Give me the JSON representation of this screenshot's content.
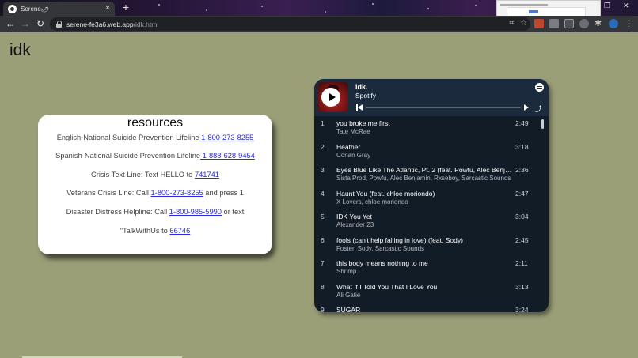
{
  "browser": {
    "tab_title": "Serene🌶",
    "tab_close": "×",
    "new_tab": "+",
    "url_host": "serene-fe3a6.web.app",
    "url_path": "/idk.html",
    "icons": [
      "back-icon",
      "forward-icon",
      "reload-icon",
      "lock-icon",
      "qr-icon",
      "star-icon",
      "extension-icon",
      "profile-icon",
      "menu-icon"
    ]
  },
  "page": {
    "heading": "idk"
  },
  "resources": {
    "title": "resources",
    "lines": [
      {
        "prefix": "English-National Suicide Prevention Lifeline",
        "link": " 1-800-273-8255",
        "suffix": ""
      },
      {
        "prefix": "Spanish-National Suicide Prevention Lifeline",
        "link": " 1-888-628-9454",
        "suffix": ""
      },
      {
        "prefix": "Crisis Text Line: Text HELLO to ",
        "link": "741741",
        "suffix": ""
      },
      {
        "prefix": "Veterans Crisis Line: Call ",
        "link": "1-800-273-8255",
        "suffix": " and press 1"
      },
      {
        "prefix": "Disaster Distress Helpline: Call ",
        "link": "1-800-985-5990",
        "suffix": " or text"
      },
      {
        "prefix": "\"TalkWithUs to ",
        "link": "66746",
        "suffix": ""
      }
    ]
  },
  "spotify": {
    "playlist_title": "idk.",
    "subtitle": "Spotify",
    "share_glyph": "⤴",
    "tracks": [
      {
        "num": "1",
        "title": "you broke me first",
        "artist": "Tate McRae",
        "duration": "2:49"
      },
      {
        "num": "2",
        "title": "Heather",
        "artist": "Conan Gray",
        "duration": "3:18"
      },
      {
        "num": "3",
        "title": "Eyes Blue Like The Atlantic, Pt. 2 (feat. Powfu, Alec Benjamin & Rxseboy)",
        "artist": "Sista Prod, Powfu, Alec Benjamin, Rxseboy, Sarcastic Sounds",
        "duration": "2:36"
      },
      {
        "num": "4",
        "title": "Haunt You (feat. chloe moriondo)",
        "artist": "X Lovers, chloe moriondo",
        "duration": "2:47"
      },
      {
        "num": "5",
        "title": "IDK You Yet",
        "artist": "Alexander 23",
        "duration": "3:04"
      },
      {
        "num": "6",
        "title": "fools (can't help falling in love) (feat. Sody)",
        "artist": "Foster, Sody, Sarcastic Sounds",
        "duration": "2:45"
      },
      {
        "num": "7",
        "title": "this body means nothing to me",
        "artist": "Shrimp",
        "duration": "2:11"
      },
      {
        "num": "8",
        "title": "What If I Told You That I Love You",
        "artist": "Ali Gatie",
        "duration": "3:13"
      },
      {
        "num": "9",
        "title": "SUGAR",
        "artist": "",
        "duration": "3:24"
      }
    ]
  },
  "colors": {
    "page_bg": "#9b9f78",
    "link": "#2a2ae0",
    "spotify_bg": "#121c26"
  }
}
